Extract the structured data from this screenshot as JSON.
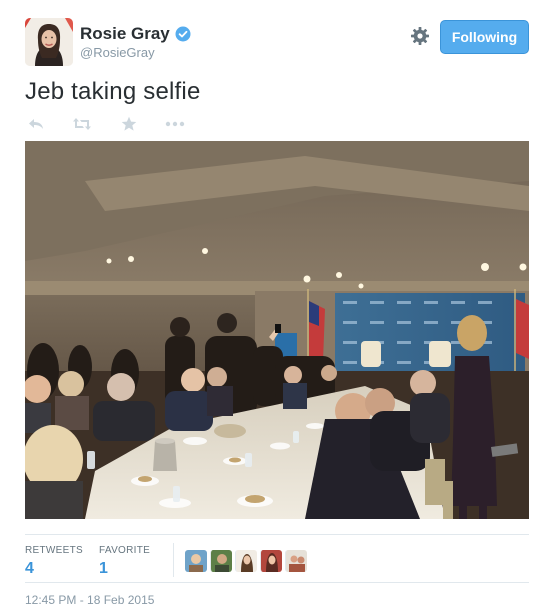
{
  "user": {
    "display_name": "Rosie Gray",
    "handle": "@RosieGray",
    "verified": true,
    "avatar_icon": "avatar-photo"
  },
  "header": {
    "follow_label": "Following",
    "settings_icon": "gear-icon"
  },
  "tweet": {
    "text": "Jeb taking selfie",
    "timestamp": "12:45 PM - 18 Feb 2015"
  },
  "actions": [
    {
      "name": "reply-icon"
    },
    {
      "name": "retweet-icon"
    },
    {
      "name": "favorite-icon"
    },
    {
      "name": "more-icon"
    }
  ],
  "stats": {
    "retweets_label": "RETWEETS",
    "retweets_value": "4",
    "favorites_label": "FAVORITE",
    "favorites_value": "1"
  },
  "colors": {
    "accent": "#55acee",
    "link": "#3b94d9",
    "muted": "#8899a6",
    "text": "#292f33"
  }
}
